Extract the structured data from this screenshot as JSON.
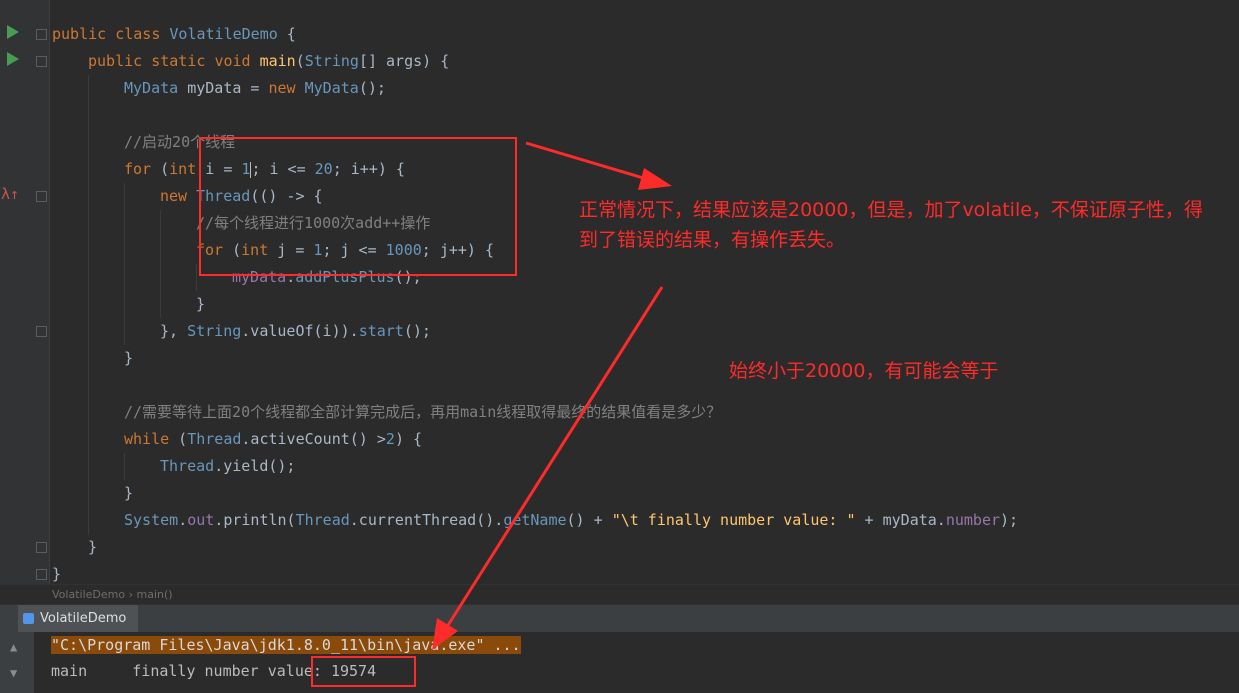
{
  "code": {
    "l1": {
      "kw1": "public",
      "kw2": "class",
      "name": "VolatileDemo",
      "brace": " {"
    },
    "l2": {
      "kw1": "public",
      "kw2": "static",
      "kw3": "void",
      "name": "main",
      "paren": "(",
      "type": "String",
      "rest": "[] args) {"
    },
    "l3": {
      "type": "MyData",
      "var": " myData = ",
      "kw": "new",
      "type2": "MyData",
      "rest": "();"
    },
    "l5": {
      "comment": "//启动20个线程"
    },
    "l6": {
      "kw1": "for",
      "p1": " (",
      "kw2": "int",
      "p2": " i = ",
      "n1": "1",
      "p3": "; i <= ",
      "n2": "20",
      "p4": "; i++) {"
    },
    "l7": {
      "kw": "new",
      "type": "Thread",
      "rest": "(() -> {"
    },
    "l8": {
      "comment": "//每个线程进行1000次add++操作"
    },
    "l9": {
      "kw1": "for",
      "p1": " (",
      "kw2": "int",
      "p2": " j = ",
      "n1": "1",
      "p3": "; j <= ",
      "n2": "1000",
      "p4": "; j++) {"
    },
    "l10": {
      "obj": "myData",
      "dot": ".",
      "m": "addPlusPlus",
      "rest": "();"
    },
    "l11": {
      "text": "}"
    },
    "l12": {
      "p1": "}, ",
      "type": "String",
      "p2": ".valueOf(i)).",
      "m": "start",
      "rest": "();"
    },
    "l13": {
      "text": "}"
    },
    "l15": {
      "comment": "//需要等待上面20个线程都全部计算完成后，再用main线程取得最终的结果值看是多少？"
    },
    "l16": {
      "kw": "while",
      "p1": " (",
      "type": "Thread",
      "p2": ".activeCount() >",
      "n": "2",
      "p3": ") {"
    },
    "l17": {
      "type": "Thread",
      "rest": ".yield();"
    },
    "l18": {
      "text": "}"
    },
    "l19": {
      "type": "System",
      "p1": ".",
      "fld": "out",
      "p2": ".println(",
      "type2": "Thread",
      "p3": ".currentThread().",
      "m": "getName",
      "p4": "() + ",
      "str": "\"\\t finally number value: \"",
      "p5": " + myData.",
      "fld2": "number",
      "p6": ");"
    },
    "l20": {
      "text": "}"
    },
    "l21": {
      "text": "}"
    }
  },
  "breadcrumb": {
    "file": "VolatileDemo",
    "sep": "›",
    "method": "main()"
  },
  "run": {
    "tab_label": "VolatileDemo"
  },
  "console": {
    "cmd": "\"C:\\Program Files\\Java\\jdk1.8.0_11\\bin\\java.exe\" ...",
    "output_label": "main     finally number value: ",
    "output_value": "19574"
  },
  "annotations": {
    "note1": "正常情况下，结果应该是20000，但是，加了volatile，不保证原子性，得到了错误的结果，有操作丢失。",
    "note2": "始终小于20000，有可能会等于"
  },
  "colors": {
    "annotation": "#ff2a2a",
    "keyword": "#cc7832",
    "class": "#6897bb",
    "comment": "#808080",
    "method": "#ffc66d",
    "field": "#9876aa"
  }
}
